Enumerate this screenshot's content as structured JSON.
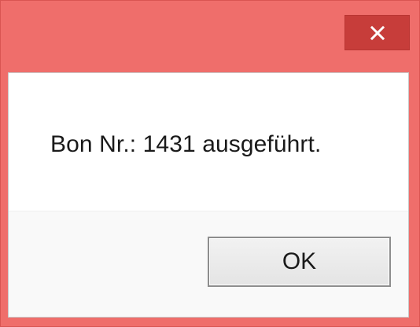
{
  "dialog": {
    "message": "Bon Nr.: 1431 ausgeführt.",
    "ok_label": "OK",
    "close_icon": "close-icon",
    "colors": {
      "frame": "#ef6e6b",
      "close_button": "#c73d3a",
      "client_background": "#ffffff",
      "button_bar_background": "#f9f9f9"
    }
  }
}
